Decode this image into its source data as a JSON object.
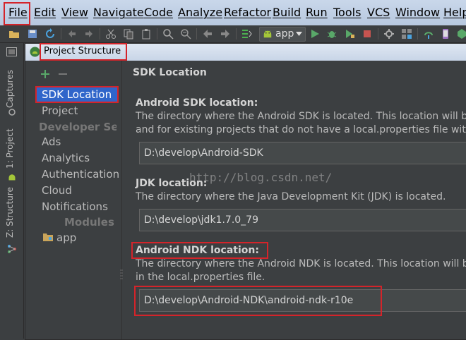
{
  "menubar": {
    "items": [
      "File",
      "Edit",
      "View",
      "Navigate",
      "Code",
      "Analyze",
      "Refactor",
      "Build",
      "Run",
      "Tools",
      "VCS",
      "Window",
      "Help"
    ]
  },
  "toolbar": {
    "run_config": "app"
  },
  "left_strip": {
    "tabs": [
      "Captures",
      "1: Project",
      "Z: Structure"
    ]
  },
  "dialog": {
    "title": "Project Structure",
    "sidebar": {
      "items": [
        {
          "label": "SDK Location",
          "selected": true
        },
        {
          "label": "Project"
        },
        {
          "label": "Developer Services",
          "header": true
        },
        {
          "label": "Ads"
        },
        {
          "label": "Analytics"
        },
        {
          "label": "Authentication"
        },
        {
          "label": "Cloud"
        },
        {
          "label": "Notifications"
        },
        {
          "label": "Modules",
          "header": true
        },
        {
          "label": "app"
        }
      ]
    },
    "content": {
      "title": "SDK Location",
      "android_sdk": {
        "heading": "Android SDK location:",
        "desc_line1": "The directory where the Android SDK is located. This location will be used for new projects,",
        "desc_line2": "and for existing projects that do not have a local.properties file with a sdk.dir property.",
        "value": "D:\\develop\\Android-SDK"
      },
      "jdk": {
        "heading": "JDK location:",
        "desc_line1": "The directory where the Java Development Kit (JDK) is located.",
        "value": "D:\\develop\\jdk1.7.0_79"
      },
      "android_ndk": {
        "heading": "Android NDK location:",
        "desc_line1": "The directory where the Android NDK is located. This location will be saved as ndk.dir property",
        "desc_line2": "in the local.properties file.",
        "value": "D:\\develop\\Android-NDK\\android-ndk-r10e"
      }
    }
  },
  "watermark": "http://blog.csdn.net/",
  "colors": {
    "selection": "#2f65ca",
    "highlight": "#d4242a",
    "background": "#3c3f41"
  }
}
